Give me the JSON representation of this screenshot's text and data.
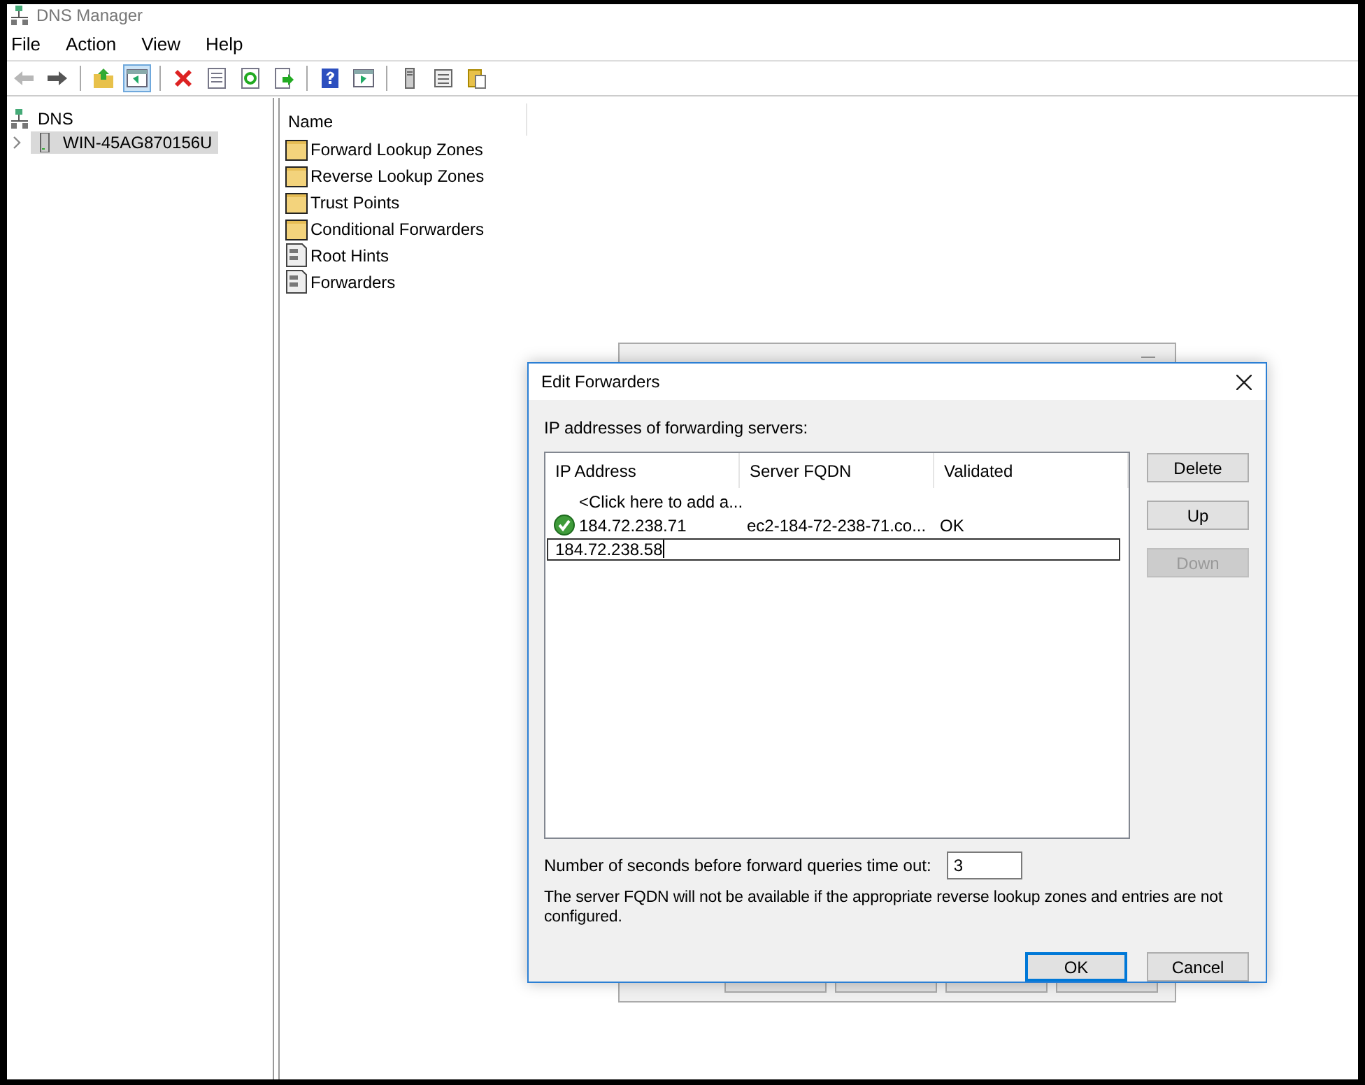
{
  "window": {
    "title": "DNS Manager"
  },
  "menu": [
    "File",
    "Action",
    "View",
    "Help"
  ],
  "toolbar": [
    {
      "kind": "back",
      "disabled": true,
      "pressed": false
    },
    {
      "kind": "forward",
      "disabled": false,
      "pressed": false
    },
    {
      "kind": "sep"
    },
    {
      "kind": "up",
      "disabled": false,
      "pressed": false
    },
    {
      "kind": "tree",
      "disabled": false,
      "pressed": true
    },
    {
      "kind": "sep"
    },
    {
      "kind": "delete",
      "disabled": false,
      "pressed": false
    },
    {
      "kind": "properties",
      "disabled": false,
      "pressed": false
    },
    {
      "kind": "refresh",
      "disabled": false,
      "pressed": false
    },
    {
      "kind": "export",
      "disabled": false,
      "pressed": false
    },
    {
      "kind": "sep"
    },
    {
      "kind": "help",
      "disabled": false,
      "pressed": false
    },
    {
      "kind": "pane",
      "disabled": false,
      "pressed": false
    },
    {
      "kind": "sep"
    },
    {
      "kind": "server",
      "disabled": false,
      "pressed": false
    },
    {
      "kind": "list",
      "disabled": false,
      "pressed": false
    },
    {
      "kind": "paste",
      "disabled": false,
      "pressed": false
    }
  ],
  "tree": {
    "label": "DNS",
    "children": [
      {
        "label": "WIN-45AG870156U",
        "selected": true,
        "expanded": false
      }
    ]
  },
  "list": {
    "columns": [
      "Name"
    ],
    "items": [
      {
        "name": "Forward Lookup Zones",
        "kind": "folder"
      },
      {
        "name": "Reverse Lookup Zones",
        "kind": "folder"
      },
      {
        "name": "Trust Points",
        "kind": "folder"
      },
      {
        "name": "Conditional Forwarders",
        "kind": "folder"
      },
      {
        "name": "Root Hints",
        "kind": "file"
      },
      {
        "name": "Forwarders",
        "kind": "file"
      }
    ]
  },
  "dialog": {
    "title": "Edit Forwarders",
    "label": "IP addresses of forwarding servers:",
    "columns": [
      "IP Address",
      "Server FQDN",
      "Validated"
    ],
    "rows": [
      {
        "kind": "add",
        "ip": "<Click here to add a..."
      },
      {
        "kind": "entry",
        "valid": true,
        "ip": "184.72.238.71",
        "fqdn": "ec2-184-72-238-71.co...",
        "validated": "OK"
      },
      {
        "kind": "editing",
        "ip": "184.72.238.58"
      }
    ],
    "side_buttons": [
      {
        "label": "Delete",
        "disabled": false
      },
      {
        "label": "Up",
        "disabled": false
      },
      {
        "label": "Down",
        "disabled": true
      }
    ],
    "timeout_label": "Number of seconds before forward queries time out:",
    "timeout_value": "3",
    "note": "The server FQDN will not be available if the appropriate reverse lookup zones and entries are not configured.",
    "buttons": [
      {
        "label": "OK",
        "default": true
      },
      {
        "label": "Cancel",
        "default": false
      }
    ]
  }
}
